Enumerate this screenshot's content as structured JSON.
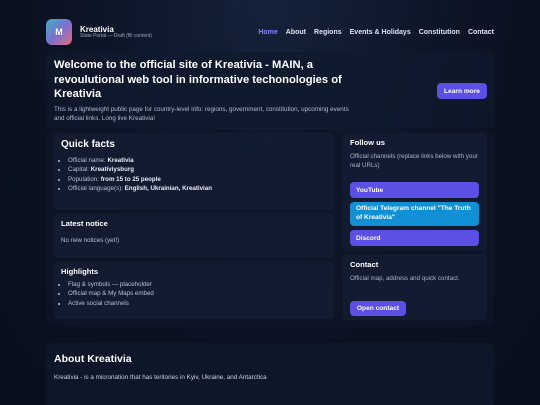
{
  "brand": {
    "logo_letter": "M",
    "name": "Kreativia",
    "subtitle": "State Portal — Draft (fill content)"
  },
  "nav": {
    "items": [
      "Home",
      "About",
      "Regions",
      "Events & Holidays",
      "Constitution",
      "Contact"
    ],
    "active": "Home"
  },
  "hero": {
    "title": "Welcome to the official site of Kreativia - MAIN, a revoulutional web tool in informative techonologies of Kreativia",
    "description": "This is a lightweight public page for country-level info: regions, government, constitution, upcoming events and official links. Long live Kreativia!",
    "learn_more": "Learn more"
  },
  "quick_facts": {
    "title": "Quick facts",
    "items": [
      {
        "label": "Official name:",
        "value": "Kreativia"
      },
      {
        "label": "Capital:",
        "value": "Kreativiysburg"
      },
      {
        "label": "Population:",
        "value": "from 15 to 25 people"
      },
      {
        "label": "Official language(s):",
        "value": "English, Ukrainian, Kreativian"
      }
    ]
  },
  "notice": {
    "title": "Latest notice",
    "text": "No new notices (yet!)"
  },
  "highlights": {
    "title": "Highlights",
    "items": [
      "Flag & symbols — placeholder",
      "Official map & My Maps embed",
      "Active social channels"
    ]
  },
  "follow": {
    "title": "Follow us",
    "description": "Official channels (replace links below with your real URLs)",
    "youtube": "YouTube",
    "telegram": "Official Telegram channel \"The Truth of Kreativia\"",
    "discord": "Discord"
  },
  "contact": {
    "title": "Contact",
    "description": "Official map, address and quick contact.",
    "button": "Open contact"
  },
  "about": {
    "title": "About Kreativia",
    "text": "Kreativia - is a micronation that has teritories in Kyiv, Ukraine, and Antarctica"
  },
  "colors": {
    "accent": "#5b4fe6",
    "nav_active": "#7f86ff",
    "telegram": "#1290d6",
    "background": "#0b1324"
  }
}
